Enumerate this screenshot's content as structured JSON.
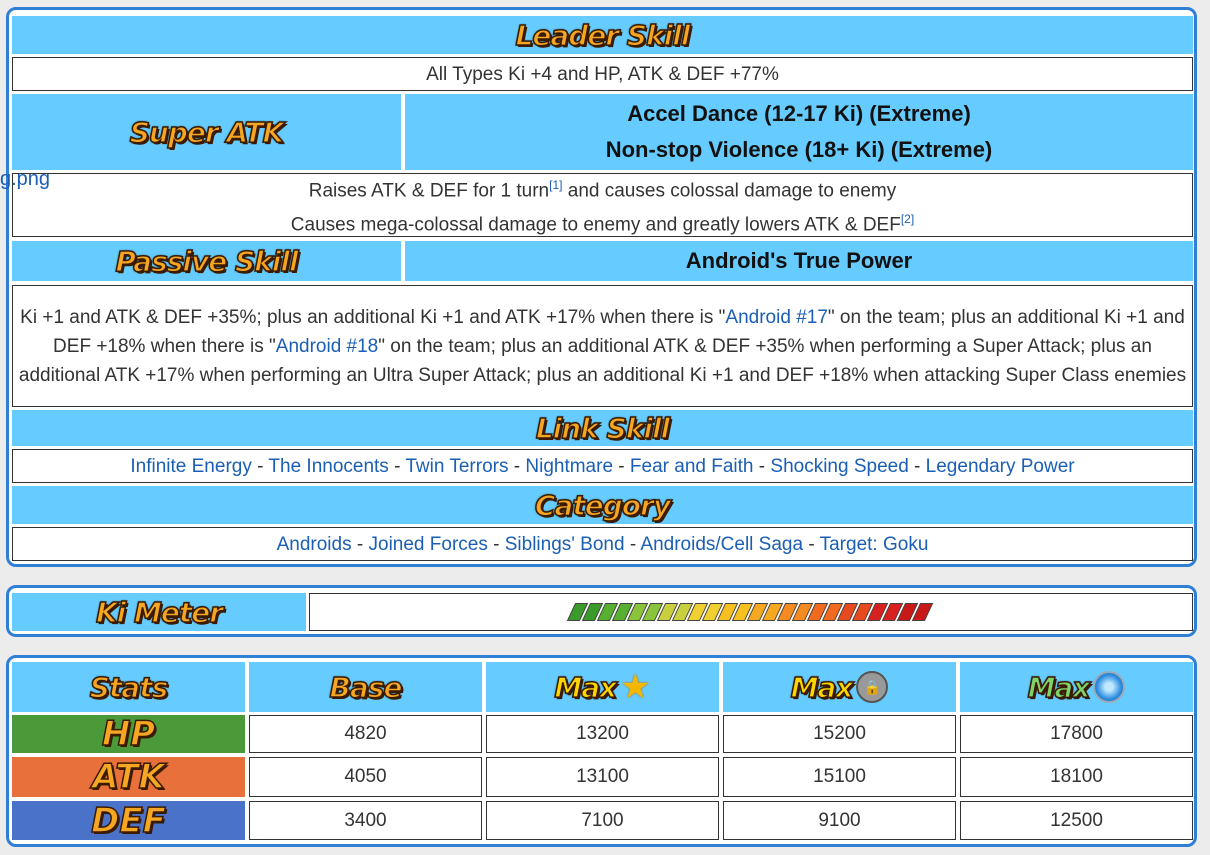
{
  "leader": {
    "header": "Leader Skill",
    "text": "All Types Ki +4 and HP, ATK & DEF +77%"
  },
  "super_atk": {
    "header": "Super ATK",
    "name1": "Accel Dance (12-17 Ki) (Extreme)",
    "name2": "Non-stop Violence (18+ Ki) (Extreme)",
    "broken_img": "g.png",
    "desc1": "Raises ATK & DEF for 1 turn",
    "desc1_ref": "[1]",
    "desc1_tail": " and causes colossal damage to enemy",
    "desc2": "Causes mega-colossal damage to enemy and greatly lowers ATK & DEF",
    "desc2_ref": "[2]"
  },
  "passive": {
    "header": "Passive Skill",
    "name": "Android's True Power",
    "part1": "Ki +1 and ATK & DEF +35%; plus an additional Ki +1 and ATK +17% when there is \"",
    "link1": "Android #17",
    "part2": "\" on the team; plus an additional Ki +1 and DEF +18% when there is \"",
    "link2": "Android #18",
    "part3": "\" on the team; plus an additional ATK & DEF +35% when performing a Super Attack; plus an additional ATK +17% when performing an Ultra Super Attack; plus an additional Ki +1 and DEF +18% when attacking Super Class enemies"
  },
  "link_skill": {
    "header": "Link Skill",
    "items": [
      "Infinite Energy",
      "The Innocents",
      "Twin Terrors",
      "Nightmare",
      "Fear and Faith",
      "Shocking Speed",
      "Legendary Power"
    ]
  },
  "category": {
    "header": "Category",
    "items": [
      "Androids",
      "Joined Forces",
      "Siblings' Bond",
      "Androids/Cell Saga",
      "Target: Goku"
    ]
  },
  "ki_meter": {
    "header": "Ki Meter",
    "segments": 24
  },
  "stats": {
    "header": "Stats",
    "col_base": "Base",
    "col_max": "Max",
    "rows": [
      {
        "label": "HP",
        "color": "#4a9a3a",
        "base": "4820",
        "max1": "13200",
        "max2": "15200",
        "max3": "17800"
      },
      {
        "label": "ATK",
        "color": "#e8703a",
        "base": "4050",
        "max1": "13100",
        "max2": "15100",
        "max3": "18100"
      },
      {
        "label": "DEF",
        "color": "#4a72c8",
        "base": "3400",
        "max1": "7100",
        "max2": "9100",
        "max3": "12500"
      }
    ]
  }
}
